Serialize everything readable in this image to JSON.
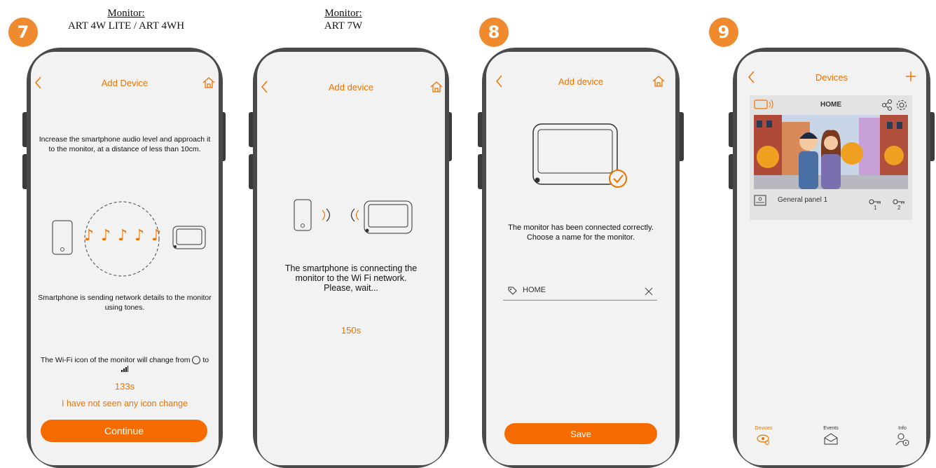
{
  "steps": [
    "7",
    "8",
    "9"
  ],
  "captions": {
    "left": {
      "heading": "Monitor:",
      "model": "ART 4W LITE / ART 4WH"
    },
    "right": {
      "heading": "Monitor:",
      "model": "ART 7W"
    }
  },
  "screen1": {
    "title": "Add Device",
    "instructions": "Increase the smartphone audio level and approach it to the monitor, at a distance of less than 10cm.",
    "sending_text": "Smartphone is sending network details to the monitor using tones.",
    "wifi_text": "The Wi-Fi icon of the monitor will change from",
    "wifi_text_to": "to",
    "countdown": "133s",
    "no_change_link": "I have not seen any icon change",
    "continue_label": "Continue",
    "notes": [
      "♪",
      "♪",
      "♪",
      "♪",
      "♪"
    ]
  },
  "screen2": {
    "title": "Add device",
    "connecting_text": "The smartphone is connecting the monitor to the Wi Fi network. Please, wait...",
    "countdown": "150s"
  },
  "screen3": {
    "title": "Add device",
    "connected_text": "The monitor has been connected correctly. Choose a name for the monitor.",
    "name_value": "HOME",
    "save_label": "Save"
  },
  "screen4": {
    "title": "Devices",
    "device_name": "HOME",
    "panel_label": "General panel 1",
    "lock1": "1",
    "lock2": "2",
    "tabs": [
      {
        "label": "Devices",
        "icon": "devices-icon",
        "active": true
      },
      {
        "label": "Events",
        "icon": "events-icon",
        "active": false
      },
      {
        "label": "Info",
        "icon": "info-icon",
        "active": false
      }
    ]
  },
  "colors": {
    "accent": "#f07300",
    "button": "#f56b00",
    "badge": "#f08a2e",
    "phone": "#4a4a4a",
    "screen": "#f2f2f2"
  }
}
